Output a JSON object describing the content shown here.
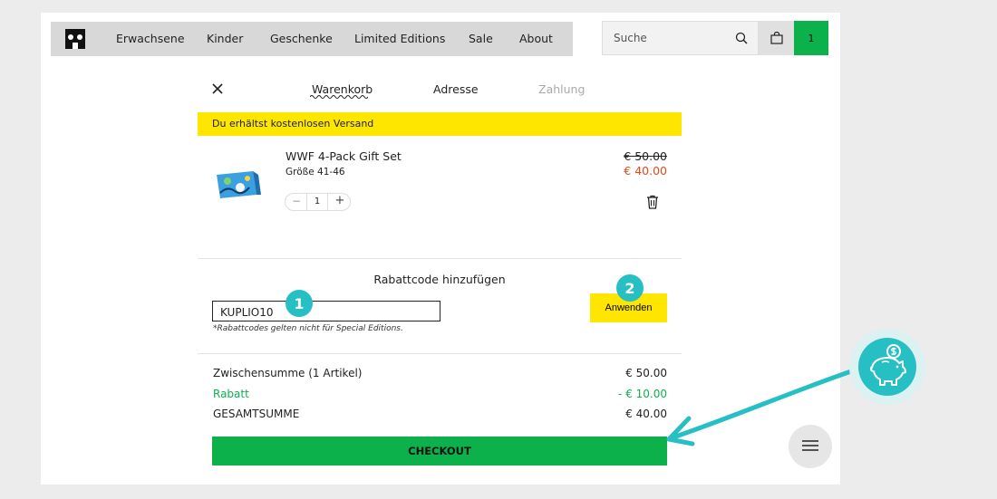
{
  "nav": {
    "items": [
      "Erwachsene",
      "Kinder",
      "Geschenke",
      "Limited Editions",
      "Sale",
      "About"
    ],
    "search_placeholder": "Suche",
    "cart_count": "1"
  },
  "steps": {
    "cart": "Warenkorb",
    "address": "Adresse",
    "payment": "Zahlung"
  },
  "banner": "Du erhältst kostenlosen Versand",
  "product": {
    "name": "WWF 4-Pack Gift Set",
    "size": "Größe 41-46",
    "old_price": "€ 50.00",
    "new_price": "€ 40.00",
    "quantity": "1",
    "minus": "−",
    "plus": "+"
  },
  "coupon": {
    "title": "Rabattcode hinzufügen",
    "value": "KUPLIO10",
    "note": "*Rabattcodes gelten nicht für Special Editions.",
    "apply": "Anwenden"
  },
  "markers": [
    "1",
    "2"
  ],
  "totals": {
    "subtotal_label": "Zwischensumme (1 Artikel)",
    "subtotal_value": "€ 50.00",
    "discount_label": "Rabatt",
    "discount_value": "- € 10.00",
    "total_label": "GESAMTSUMME",
    "total_value": "€ 40.00"
  },
  "checkout": "CHECKOUT",
  "colors": {
    "accent_green": "#0db14b",
    "yellow": "#ffe600",
    "teal": "#26bfc4",
    "sale_red": "#e8471a"
  }
}
